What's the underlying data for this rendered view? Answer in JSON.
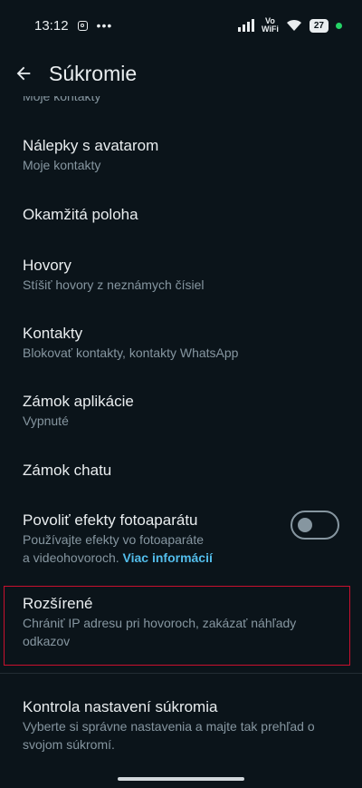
{
  "status_bar": {
    "time": "13:12",
    "battery": "27",
    "vowifi_top": "Vo",
    "vowifi_bottom": "WiFi"
  },
  "header": {
    "title": "Súkromie"
  },
  "items": [
    {
      "subtitle": "Moje kontakty"
    },
    {
      "title": "Nálepky s avatarom",
      "subtitle": "Moje kontakty"
    },
    {
      "title": "Okamžitá poloha"
    },
    {
      "title": "Hovory",
      "subtitle": "Stíšiť hovory z neznámych čísiel"
    },
    {
      "title": "Kontakty",
      "subtitle": "Blokovať kontakty, kontakty WhatsApp"
    },
    {
      "title": "Zámok aplikácie",
      "subtitle": "Vypnuté"
    },
    {
      "title": "Zámok chatu"
    },
    {
      "title": "Povoliť efekty fotoaparátu",
      "subtitle_line1": "Používajte efekty vo fotoaparáte",
      "subtitle_line2": "a videohovoroch.",
      "link": "Viac informácií",
      "toggle_on": false
    },
    {
      "title": "Rozšírené",
      "subtitle": "Chrániť IP adresu pri hovoroch, zakázať náhľady odkazov"
    },
    {
      "title": "Kontrola nastavení súkromia",
      "subtitle": "Vyberte si správne nastavenia a majte tak prehľad o svojom súkromí."
    }
  ],
  "colors": {
    "background": "#0b141a",
    "text": "#e9edef",
    "subtext": "#8696a0",
    "link": "#53bdeb",
    "highlight": "#c8102e"
  }
}
